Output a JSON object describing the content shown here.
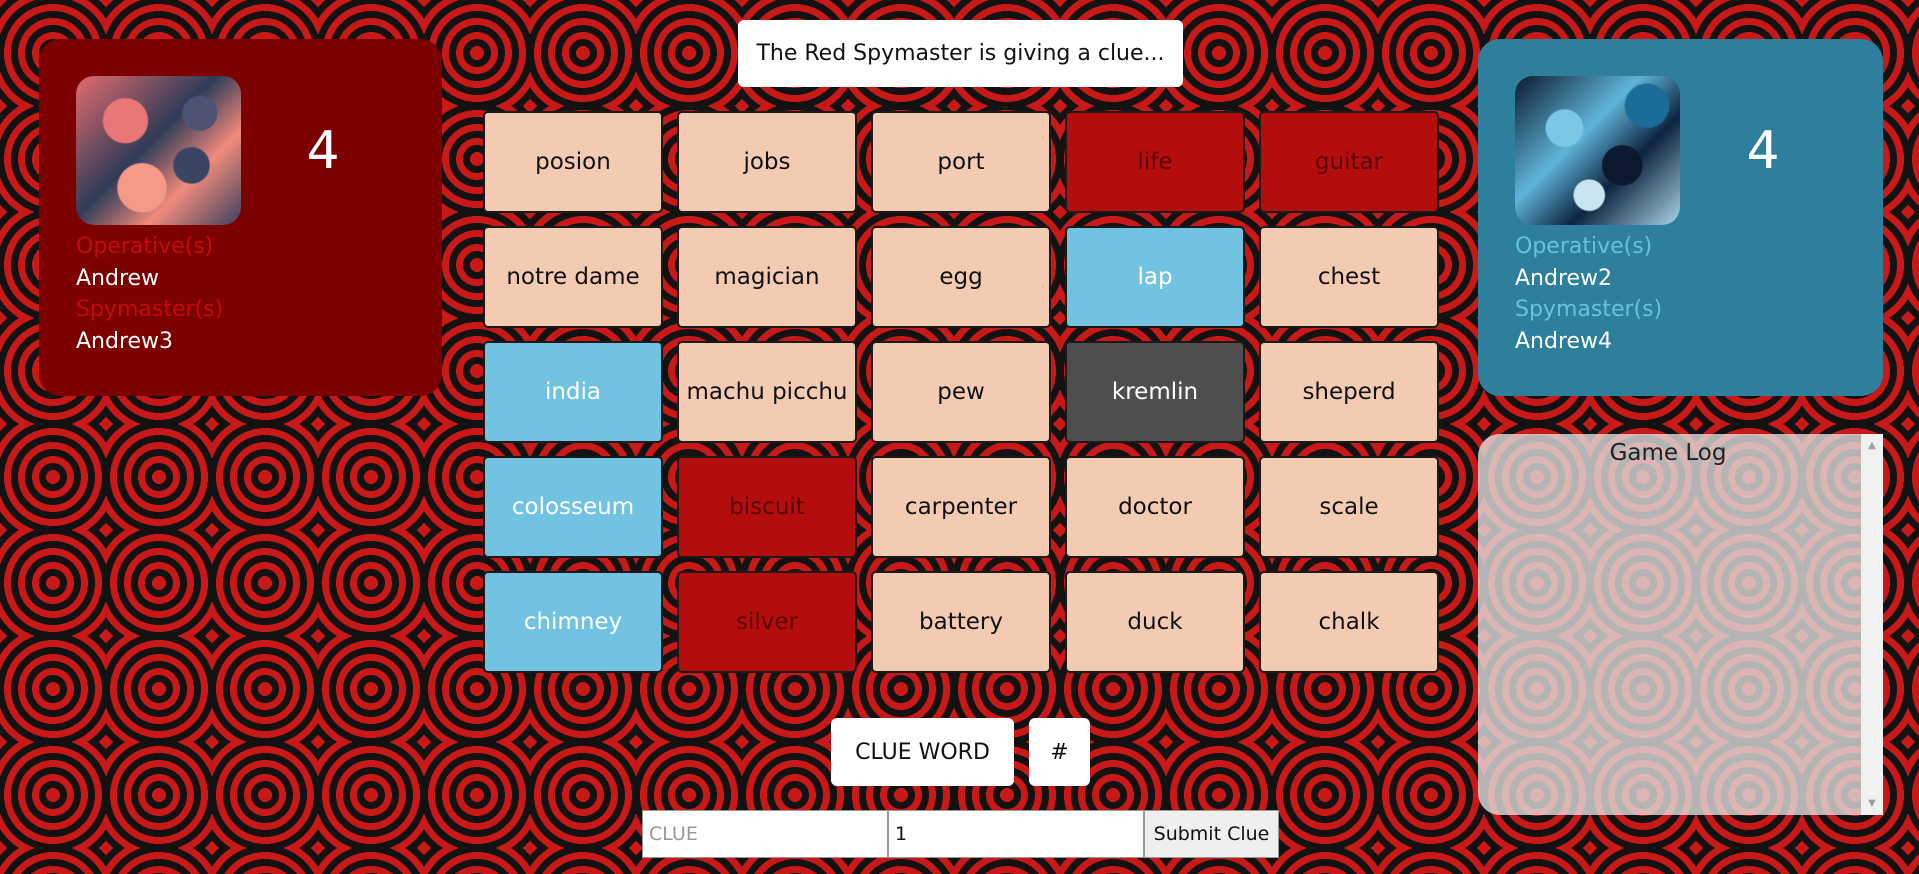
{
  "status": "The Red Spymaster is giving a clue...",
  "red_team": {
    "score": "4",
    "operatives_label": "Operative(s)",
    "operatives": [
      "Andrew"
    ],
    "spymasters_label": "Spymaster(s)",
    "spymasters": [
      "Andrew3"
    ],
    "color": "#7d0000"
  },
  "blue_team": {
    "score": "4",
    "operatives_label": "Operative(s)",
    "operatives": [
      "Andrew2"
    ],
    "spymasters_label": "Spymaster(s)",
    "spymasters": [
      "Andrew4"
    ],
    "color": "#2e7f9c"
  },
  "board": [
    {
      "word": "posion",
      "team": "neutral"
    },
    {
      "word": "jobs",
      "team": "neutral"
    },
    {
      "word": "port",
      "team": "neutral"
    },
    {
      "word": "life",
      "team": "red"
    },
    {
      "word": "guitar",
      "team": "red"
    },
    {
      "word": "notre dame",
      "team": "neutral"
    },
    {
      "word": "magician",
      "team": "neutral"
    },
    {
      "word": "egg",
      "team": "neutral"
    },
    {
      "word": "lap",
      "team": "blue"
    },
    {
      "word": "chest",
      "team": "neutral"
    },
    {
      "word": "india",
      "team": "blue"
    },
    {
      "word": "machu picchu",
      "team": "neutral"
    },
    {
      "word": "pew",
      "team": "neutral"
    },
    {
      "word": "kremlin",
      "team": "black"
    },
    {
      "word": "sheperd",
      "team": "neutral"
    },
    {
      "word": "colosseum",
      "team": "blue"
    },
    {
      "word": "biscuit",
      "team": "red"
    },
    {
      "word": "carpenter",
      "team": "neutral"
    },
    {
      "word": "doctor",
      "team": "neutral"
    },
    {
      "word": "scale",
      "team": "neutral"
    },
    {
      "word": "chimney",
      "team": "blue"
    },
    {
      "word": "silver",
      "team": "red"
    },
    {
      "word": "battery",
      "team": "neutral"
    },
    {
      "word": "duck",
      "team": "neutral"
    },
    {
      "word": "chalk",
      "team": "neutral"
    }
  ],
  "clue_display": {
    "word": "CLUE WORD",
    "number": "#"
  },
  "clue_form": {
    "clue_placeholder": "CLUE",
    "number_value": "1",
    "submit_label": "Submit Clue"
  },
  "game_log": {
    "title": "Game Log"
  },
  "colors": {
    "neutral": "#f3cbb3",
    "red": "#b30d0d",
    "blue": "#72c3e2",
    "assassin": "#4e4e4e"
  }
}
